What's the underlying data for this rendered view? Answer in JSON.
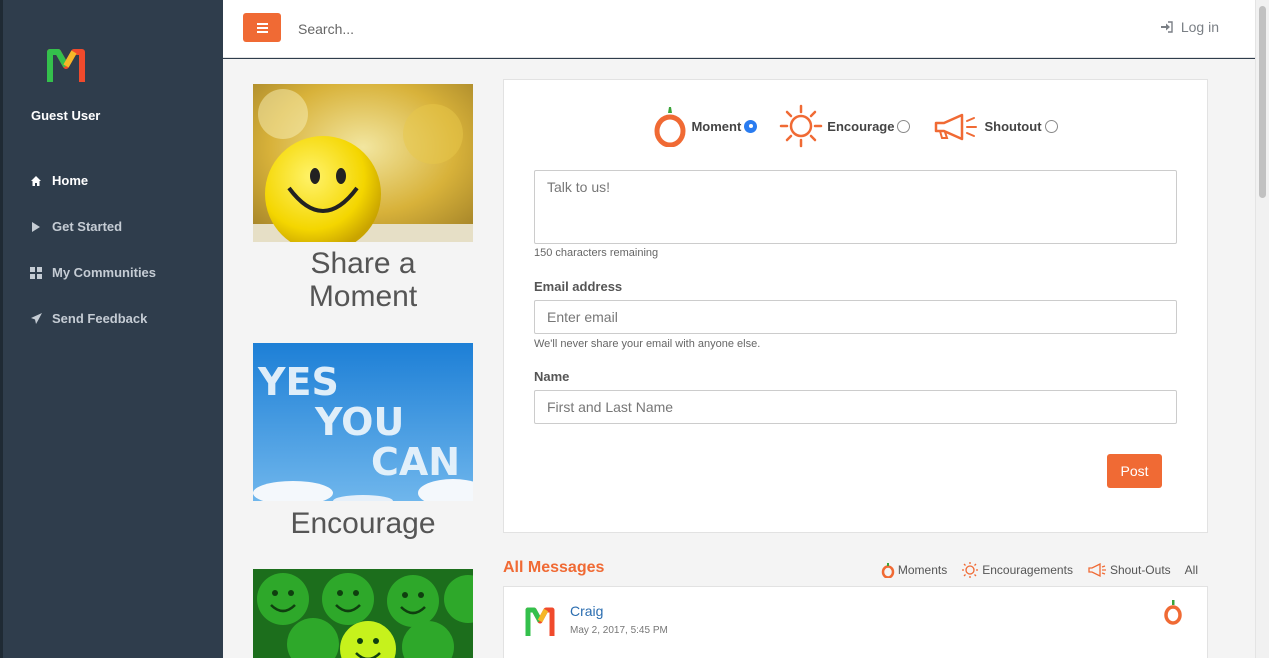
{
  "sidebar": {
    "user": "Guest User",
    "items": [
      {
        "label": "Home",
        "icon": "home-icon"
      },
      {
        "label": "Get Started",
        "icon": "play-icon"
      },
      {
        "label": "My Communities",
        "icon": "grid-icon"
      },
      {
        "label": "Send Feedback",
        "icon": "paper-plane-icon"
      }
    ]
  },
  "topbar": {
    "search_placeholder": "Search...",
    "login_label": "Log in"
  },
  "promos": [
    {
      "caption_line1": "Share a",
      "caption_line2": "Moment"
    },
    {
      "caption_line1": "Encourage"
    },
    {
      "caption_line1": ""
    }
  ],
  "form": {
    "types": [
      {
        "label": "Moment",
        "selected": true
      },
      {
        "label": "Encourage",
        "selected": false
      },
      {
        "label": "Shoutout",
        "selected": false
      }
    ],
    "message_placeholder": "Talk to us!",
    "chars_remaining": "150 characters remaining",
    "email_label": "Email address",
    "email_placeholder": "Enter email",
    "email_help": "We'll never share your email with anyone else.",
    "name_label": "Name",
    "name_placeholder": "First and Last Name",
    "post_label": "Post"
  },
  "messages": {
    "title": "All Messages",
    "filters": [
      "Moments",
      "Encouragements",
      "Shout-Outs",
      "All"
    ],
    "items": [
      {
        "name": "Craig",
        "date": "May 2, 2017, 5:45 PM"
      }
    ]
  },
  "colors": {
    "accent": "#f06a34",
    "sidebar": "#2f3d4c",
    "link": "#2a6db0"
  }
}
